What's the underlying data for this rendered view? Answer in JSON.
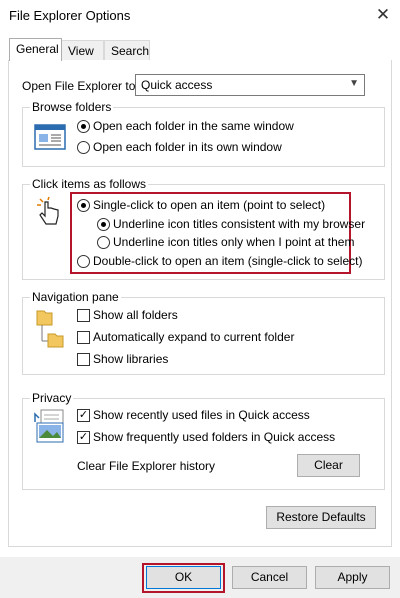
{
  "window": {
    "title": "File Explorer Options"
  },
  "tabs": [
    {
      "label": "General",
      "active": true
    },
    {
      "label": "View",
      "active": false
    },
    {
      "label": "Search",
      "active": false
    }
  ],
  "open_to": {
    "label": "Open File Explorer to:",
    "value": "Quick access"
  },
  "browse": {
    "title": "Browse folders",
    "options": [
      {
        "label": "Open each folder in the same window",
        "selected": true
      },
      {
        "label": "Open each folder in its own window",
        "selected": false
      }
    ]
  },
  "click": {
    "title": "Click items as follows",
    "single": {
      "label": "Single-click to open an item (point to select)",
      "selected": true
    },
    "sub": [
      {
        "label": "Underline icon titles consistent with my browser",
        "selected": true
      },
      {
        "label": "Underline icon titles only when I point at them",
        "selected": false
      }
    ],
    "double": {
      "label": "Double-click to open an item (single-click to select)",
      "selected": false
    }
  },
  "nav": {
    "title": "Navigation pane",
    "items": [
      {
        "label": "Show all folders",
        "checked": false
      },
      {
        "label": "Automatically expand to current folder",
        "checked": false
      },
      {
        "label": "Show libraries",
        "checked": false
      }
    ]
  },
  "privacy": {
    "title": "Privacy",
    "items": [
      {
        "label": "Show recently used files in Quick access",
        "checked": true
      },
      {
        "label": "Show frequently used folders in Quick access",
        "checked": true
      }
    ],
    "clear_label": "Clear File Explorer history",
    "clear_button": "Clear"
  },
  "restore_button": "Restore Defaults",
  "footer": {
    "ok": "OK",
    "cancel": "Cancel",
    "apply": "Apply"
  },
  "colors": {
    "highlight_border": "#b5152b",
    "accent": "#0078d7"
  },
  "icons": [
    "close-icon",
    "chevron-down-icon",
    "window-icon",
    "pointer-hand-icon",
    "folder-tree-icon",
    "privacy-icon"
  ]
}
